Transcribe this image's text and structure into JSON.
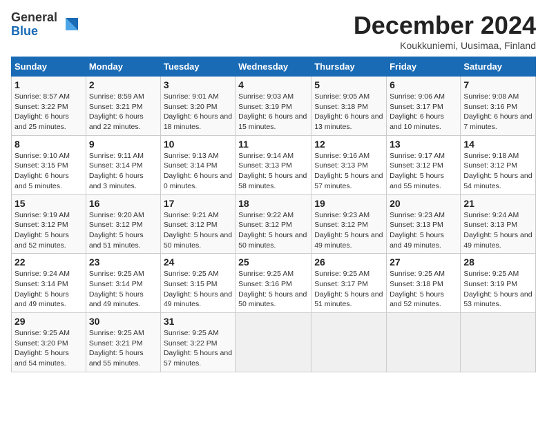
{
  "logo": {
    "general": "General",
    "blue": "Blue"
  },
  "title": "December 2024",
  "subtitle": "Koukkuniemi, Uusimaa, Finland",
  "headers": [
    "Sunday",
    "Monday",
    "Tuesday",
    "Wednesday",
    "Thursday",
    "Friday",
    "Saturday"
  ],
  "weeks": [
    [
      {
        "day": "1",
        "sunrise": "Sunrise: 8:57 AM",
        "sunset": "Sunset: 3:22 PM",
        "daylight": "Daylight: 6 hours and 25 minutes."
      },
      {
        "day": "2",
        "sunrise": "Sunrise: 8:59 AM",
        "sunset": "Sunset: 3:21 PM",
        "daylight": "Daylight: 6 hours and 22 minutes."
      },
      {
        "day": "3",
        "sunrise": "Sunrise: 9:01 AM",
        "sunset": "Sunset: 3:20 PM",
        "daylight": "Daylight: 6 hours and 18 minutes."
      },
      {
        "day": "4",
        "sunrise": "Sunrise: 9:03 AM",
        "sunset": "Sunset: 3:19 PM",
        "daylight": "Daylight: 6 hours and 15 minutes."
      },
      {
        "day": "5",
        "sunrise": "Sunrise: 9:05 AM",
        "sunset": "Sunset: 3:18 PM",
        "daylight": "Daylight: 6 hours and 13 minutes."
      },
      {
        "day": "6",
        "sunrise": "Sunrise: 9:06 AM",
        "sunset": "Sunset: 3:17 PM",
        "daylight": "Daylight: 6 hours and 10 minutes."
      },
      {
        "day": "7",
        "sunrise": "Sunrise: 9:08 AM",
        "sunset": "Sunset: 3:16 PM",
        "daylight": "Daylight: 6 hours and 7 minutes."
      }
    ],
    [
      {
        "day": "8",
        "sunrise": "Sunrise: 9:10 AM",
        "sunset": "Sunset: 3:15 PM",
        "daylight": "Daylight: 6 hours and 5 minutes."
      },
      {
        "day": "9",
        "sunrise": "Sunrise: 9:11 AM",
        "sunset": "Sunset: 3:14 PM",
        "daylight": "Daylight: 6 hours and 3 minutes."
      },
      {
        "day": "10",
        "sunrise": "Sunrise: 9:13 AM",
        "sunset": "Sunset: 3:14 PM",
        "daylight": "Daylight: 6 hours and 0 minutes."
      },
      {
        "day": "11",
        "sunrise": "Sunrise: 9:14 AM",
        "sunset": "Sunset: 3:13 PM",
        "daylight": "Daylight: 5 hours and 58 minutes."
      },
      {
        "day": "12",
        "sunrise": "Sunrise: 9:16 AM",
        "sunset": "Sunset: 3:13 PM",
        "daylight": "Daylight: 5 hours and 57 minutes."
      },
      {
        "day": "13",
        "sunrise": "Sunrise: 9:17 AM",
        "sunset": "Sunset: 3:12 PM",
        "daylight": "Daylight: 5 hours and 55 minutes."
      },
      {
        "day": "14",
        "sunrise": "Sunrise: 9:18 AM",
        "sunset": "Sunset: 3:12 PM",
        "daylight": "Daylight: 5 hours and 54 minutes."
      }
    ],
    [
      {
        "day": "15",
        "sunrise": "Sunrise: 9:19 AM",
        "sunset": "Sunset: 3:12 PM",
        "daylight": "Daylight: 5 hours and 52 minutes."
      },
      {
        "day": "16",
        "sunrise": "Sunrise: 9:20 AM",
        "sunset": "Sunset: 3:12 PM",
        "daylight": "Daylight: 5 hours and 51 minutes."
      },
      {
        "day": "17",
        "sunrise": "Sunrise: 9:21 AM",
        "sunset": "Sunset: 3:12 PM",
        "daylight": "Daylight: 5 hours and 50 minutes."
      },
      {
        "day": "18",
        "sunrise": "Sunrise: 9:22 AM",
        "sunset": "Sunset: 3:12 PM",
        "daylight": "Daylight: 5 hours and 50 minutes."
      },
      {
        "day": "19",
        "sunrise": "Sunrise: 9:23 AM",
        "sunset": "Sunset: 3:12 PM",
        "daylight": "Daylight: 5 hours and 49 minutes."
      },
      {
        "day": "20",
        "sunrise": "Sunrise: 9:23 AM",
        "sunset": "Sunset: 3:13 PM",
        "daylight": "Daylight: 5 hours and 49 minutes."
      },
      {
        "day": "21",
        "sunrise": "Sunrise: 9:24 AM",
        "sunset": "Sunset: 3:13 PM",
        "daylight": "Daylight: 5 hours and 49 minutes."
      }
    ],
    [
      {
        "day": "22",
        "sunrise": "Sunrise: 9:24 AM",
        "sunset": "Sunset: 3:14 PM",
        "daylight": "Daylight: 5 hours and 49 minutes."
      },
      {
        "day": "23",
        "sunrise": "Sunrise: 9:25 AM",
        "sunset": "Sunset: 3:14 PM",
        "daylight": "Daylight: 5 hours and 49 minutes."
      },
      {
        "day": "24",
        "sunrise": "Sunrise: 9:25 AM",
        "sunset": "Sunset: 3:15 PM",
        "daylight": "Daylight: 5 hours and 49 minutes."
      },
      {
        "day": "25",
        "sunrise": "Sunrise: 9:25 AM",
        "sunset": "Sunset: 3:16 PM",
        "daylight": "Daylight: 5 hours and 50 minutes."
      },
      {
        "day": "26",
        "sunrise": "Sunrise: 9:25 AM",
        "sunset": "Sunset: 3:17 PM",
        "daylight": "Daylight: 5 hours and 51 minutes."
      },
      {
        "day": "27",
        "sunrise": "Sunrise: 9:25 AM",
        "sunset": "Sunset: 3:18 PM",
        "daylight": "Daylight: 5 hours and 52 minutes."
      },
      {
        "day": "28",
        "sunrise": "Sunrise: 9:25 AM",
        "sunset": "Sunset: 3:19 PM",
        "daylight": "Daylight: 5 hours and 53 minutes."
      }
    ],
    [
      {
        "day": "29",
        "sunrise": "Sunrise: 9:25 AM",
        "sunset": "Sunset: 3:20 PM",
        "daylight": "Daylight: 5 hours and 54 minutes."
      },
      {
        "day": "30",
        "sunrise": "Sunrise: 9:25 AM",
        "sunset": "Sunset: 3:21 PM",
        "daylight": "Daylight: 5 hours and 55 minutes."
      },
      {
        "day": "31",
        "sunrise": "Sunrise: 9:25 AM",
        "sunset": "Sunset: 3:22 PM",
        "daylight": "Daylight: 5 hours and 57 minutes."
      },
      null,
      null,
      null,
      null
    ]
  ]
}
